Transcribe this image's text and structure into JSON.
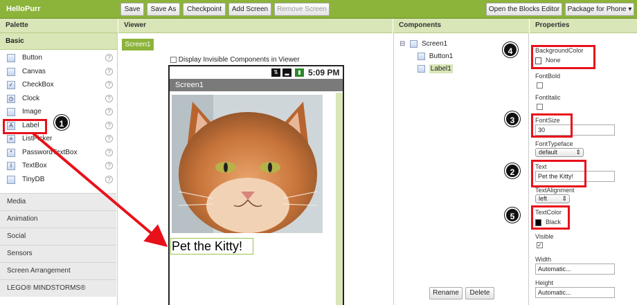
{
  "app": {
    "title": "HelloPurr"
  },
  "toolbar": {
    "save": "Save",
    "save_as": "Save As",
    "checkpoint": "Checkpoint",
    "add_screen": "Add Screen",
    "remove_screen": "Remove Screen",
    "blocks_editor": "Open the Blocks Editor",
    "package": "Package for Phone ▾"
  },
  "columns": {
    "palette": "Palette",
    "viewer": "Viewer",
    "components": "Components",
    "properties": "Properties"
  },
  "palette": {
    "basic": "Basic",
    "items": [
      {
        "label": "Button",
        "icon": "button-icon",
        "glyph": ""
      },
      {
        "label": "Canvas",
        "icon": "canvas-icon",
        "glyph": ""
      },
      {
        "label": "CheckBox",
        "icon": "checkbox-icon",
        "glyph": "✓"
      },
      {
        "label": "Clock",
        "icon": "clock-icon",
        "glyph": "◷"
      },
      {
        "label": "Image",
        "icon": "image-icon",
        "glyph": ""
      },
      {
        "label": "Label",
        "icon": "label-icon",
        "glyph": "A"
      },
      {
        "label": "ListPicker",
        "icon": "listpicker-icon",
        "glyph": "≡"
      },
      {
        "label": "PasswordTextBox",
        "icon": "password-icon",
        "glyph": "*"
      },
      {
        "label": "TextBox",
        "icon": "textbox-icon",
        "glyph": "I"
      },
      {
        "label": "TinyDB",
        "icon": "database-icon",
        "glyph": ""
      }
    ],
    "help": "?",
    "categories": [
      "Media",
      "Animation",
      "Social",
      "Sensors",
      "Screen Arrangement",
      "LEGO® MINDSTORMS®"
    ]
  },
  "viewer": {
    "screen_tab": "Screen1",
    "display_invisible": "Display Invisible Components in Viewer",
    "clock": "5:09 PM",
    "screen_title": "Screen1",
    "label_text": "Pet the Kitty!"
  },
  "components": {
    "tree": [
      "Screen1",
      "Button1",
      "Label1"
    ],
    "collapse": "⊟",
    "rename": "Rename",
    "delete": "Delete"
  },
  "properties": {
    "background_color": {
      "label": "BackgroundColor",
      "value": "None",
      "swatch": "#ffffff"
    },
    "font_bold": {
      "label": "FontBold"
    },
    "font_italic": {
      "label": "FontItalic"
    },
    "font_size": {
      "label": "FontSize",
      "value": "30"
    },
    "font_typeface": {
      "label": "FontTypeface",
      "value": "default"
    },
    "text": {
      "label": "Text",
      "value": "Pet the Kitty!"
    },
    "text_alignment": {
      "label": "TextAlignment",
      "value": "left"
    },
    "text_color": {
      "label": "TextColor",
      "value": "Black",
      "swatch": "#000000"
    },
    "visible": {
      "label": "Visible",
      "checked": "✓"
    },
    "width": {
      "label": "Width",
      "value": "Automatic..."
    },
    "height": {
      "label": "Height",
      "value": "Automatic..."
    }
  },
  "annotations": {
    "badges": [
      "1",
      "2",
      "3",
      "4",
      "5"
    ],
    "color": "#e8101a"
  },
  "colors": {
    "accent": "#8cb33a",
    "header": "#d9e6b8"
  }
}
